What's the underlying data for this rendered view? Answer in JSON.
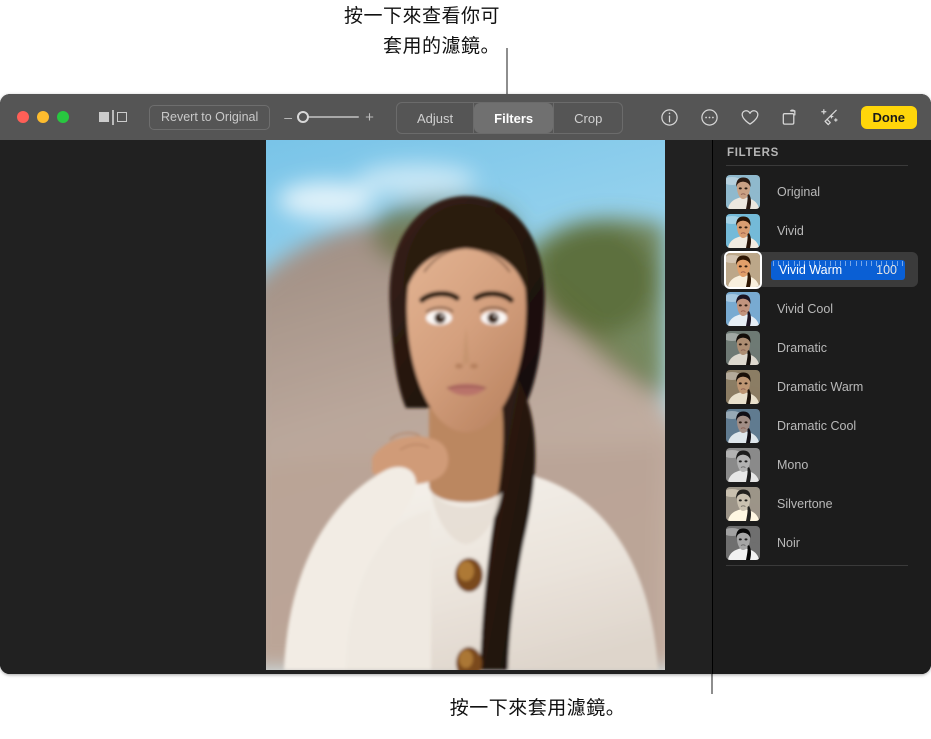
{
  "callouts": {
    "top": "按一下來查看你可\n套用的濾鏡。",
    "bottom": "按一下來套用濾鏡。"
  },
  "window": {
    "traffic_lights": {
      "close": "close-button",
      "minimize": "minimize-button",
      "zoom": "zoom-button"
    },
    "toolbar": {
      "sidebar_toggle_icon": "sidebar-toggle-icon",
      "revert_label": "Revert to Original",
      "zoom_out_label": "–",
      "zoom_in_label": "+",
      "zoom_value": 0,
      "segments": [
        {
          "label": "Adjust",
          "active": false
        },
        {
          "label": "Filters",
          "active": true
        },
        {
          "label": "Crop",
          "active": false
        }
      ],
      "icons": [
        {
          "name": "info-icon",
          "glyph": "i"
        },
        {
          "name": "more-options-icon",
          "glyph": "..."
        },
        {
          "name": "favorite-heart-icon",
          "glyph": "heart"
        },
        {
          "name": "rotate-icon",
          "glyph": "rotate"
        },
        {
          "name": "auto-enhance-icon",
          "glyph": "wand"
        }
      ],
      "done_label": "Done"
    }
  },
  "sidebar": {
    "title": "FILTERS",
    "filters": [
      {
        "label": "Original",
        "selected": false
      },
      {
        "label": "Vivid",
        "selected": false
      },
      {
        "label": "Vivid Warm",
        "selected": true,
        "value": "100"
      },
      {
        "label": "Vivid Cool",
        "selected": false
      },
      {
        "label": "Dramatic",
        "selected": false
      },
      {
        "label": "Dramatic Warm",
        "selected": false
      },
      {
        "label": "Dramatic Cool",
        "selected": false
      },
      {
        "label": "Mono",
        "selected": false
      },
      {
        "label": "Silvertone",
        "selected": false
      },
      {
        "label": "Noir",
        "selected": false
      }
    ]
  },
  "colors": {
    "accent_blue": "#0a5fd4",
    "done_yellow": "#ffd60a",
    "toolbar_gray": "#555555",
    "panel_dark": "#1c1c1c",
    "canvas_dark": "#212121"
  }
}
